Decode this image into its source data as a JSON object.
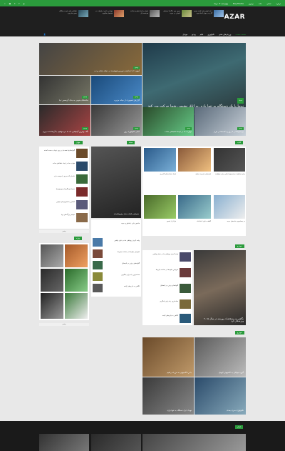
{
  "topbar": {
    "links": [
      "برترین",
      "خانه",
      "تماس",
      "درباره",
      "Buy Theme"
    ],
    "date": "چهارشنبه ۱۴ مرداد",
    "social_icons": [
      "search-icon",
      "feed-icon",
      "twitter-icon",
      "facebook-icon",
      "google-icon"
    ]
  },
  "header": {
    "logo_prefix": "",
    "logo_main": "AZAR",
    "top_news": [
      "با نام اولین تولید کننده موتور گازی در جهان آشنا شوید",
      "بیرون بوی خاک‌ها: بچه‌های آسیایی در جنوب",
      "ایمیل و اخبار فناوری ساعت هوشمند اپل",
      "مهمانی دانش: ریاضیات در فیلم‌های هالیوود",
      "خطایابی های رایج در هنگام بستن مادربورد"
    ],
    "nav_items": [
      "صفحه نخست",
      "ورزش‌های ذهنی",
      "تکنولوژی",
      "فیلم",
      "ویدیو",
      "موبایل"
    ]
  },
  "hero": {
    "main_badge": "مجله",
    "main_title": "نوجا با یک دستگاه به تنها بازی به اتاق نشیمن شما حرکت می کند",
    "main_excerpt": "بزرگترین شرکت‌های سازنده کنسول بازی در حال تحقیق و توسعه گجت‌های جدید برای ارتقای تجربه کاربری هستند.",
    "tiles": [
      {
        "badge": "ویدیو",
        "title": "آیفون ۶ با بارکردن دوربین هوشمند در دنیای رایانه و نت"
      },
      {
        "badge": "ویدیو",
        "title": "گزارش تصویری از میانه جزیره"
      },
      {
        "badge": "ویدیو",
        "title": "بی‌سیم‌ها در ۴ روز و دکمه‌ها در بازار"
      },
      {
        "badge": "ویدیو",
        "title": "مهارت ما در ایجاد اشتباهی ساده"
      },
      {
        "badge": "ویدیو",
        "title": "جاده‌های جنوبی به جای گرمسیر: بیا"
      },
      {
        "badge": "ویدیو",
        "title": "نگاه بهترین گیم‌هایی که ما می‌خواهیم با آن‌ها لذت ببریم"
      },
      {
        "badge": "ویدیو",
        "title": "اخبار تکنولوژی روز"
      }
    ]
  },
  "sections": {
    "news_label": "مجله",
    "left_label": "جهان",
    "mid_label": "ویژه",
    "right_label": "کتاب",
    "left_list": [
      "گیم‌استار‌ها همه‌جا بر روی نوجا به دست آمدند",
      "مهارت ما در ایجاد خطاهای ساده",
      "خانه‌ای که مردم را دوست دارد",
      "سرماخوردگی‌ها و ویروس‌ها",
      "آشنایی با فناوری‌های مولتی",
      "خواهر بزرگ‌های زیبا"
    ],
    "left_more": "بیشتر",
    "grid_captions": [
      "برای مبتدیان: دو فرمول اصلی برای موفقیت",
      "ابزارهای مدیریت زمان",
      "ایجاد حساب‌های کاربری",
      "در جستجوی جاده‌های جدید",
      "کشف دنیای ناشناخته",
      "فراتر از تصور"
    ],
    "feature_title": "معرفی رایانه جدید ریزپردازنده",
    "feature_caption": "ماشین بازی با فناوری جدید",
    "mid_list": [
      "پیاده کردن رویاهای ما در دنیای واقعی",
      "افزایش جلوه‌ها در ساخت بازی‌ها",
      "گلوله‌های برفی در تابستان",
      "ساده‌ترین راه برای یادگیری",
      "نگاهی به بازی‌های آینده"
    ],
    "mid_more": "بیشتر",
    "car_badge": "خودرو",
    "car_title": "نگاهی به مشخصات پورشه در سال ۲۰۱۵ ورزشکار کرد",
    "bottom_badge": "خودرو",
    "bottom_title": "با برد کامیونی به مزرعه رفتیم",
    "bottom_tiles": [
      "گروه جوانان به کامپیوتر کوچک",
      "نوجا با یک دستگاه به تنها بازی",
      "تکنولوژی سری بعدی",
      "نکاتی برای یک سفر خوب"
    ]
  },
  "footer": {
    "label": "اخبار"
  },
  "colors": {
    "accent": "#2b9b3c",
    "header_bg": "#1f1f1f",
    "page_bg": "#e8e8e8"
  }
}
